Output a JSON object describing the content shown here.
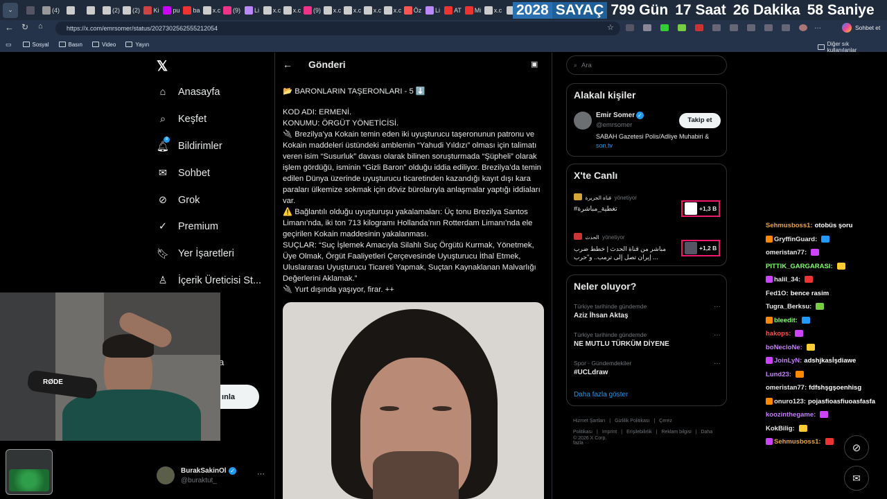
{
  "tabs": [
    "",
    "(4)",
    "",
    "",
    "(2)",
    "(2)",
    "Ki",
    "pu",
    "ba",
    "x.c",
    "(9)",
    "Li",
    "x.c",
    "x.c",
    "(9)",
    "x.c",
    "x.c",
    "x.c",
    "x.c",
    "Öz",
    "Li",
    "AT",
    "Mi",
    "x.c",
    "x"
  ],
  "countdown": {
    "year": "2028",
    "label": "SAYAÇ",
    "days": "799 Gün",
    "hours": "17 Saat",
    "minutes": "26 Dakika",
    "seconds": "58 Saniye"
  },
  "browser": {
    "url": "https://x.com/emrsomer/status/2027302562555212054",
    "chat_label": "Sohbet et"
  },
  "bookmarks": [
    "Sosyal",
    "Basın",
    "Video",
    "Yayın"
  ],
  "bookmarks_other": "Diğer sık kullanılanlar",
  "nav": {
    "home": "Anasayfa",
    "explore": "Keşfet",
    "notifications": "Bildirimler",
    "notif_count": "8",
    "chat": "Sohbet",
    "grok": "Grok",
    "premium": "Premium",
    "bookmarks": "Yer İşaretleri",
    "creator": "İçerik Üreticisi St...",
    "post_frag": "ınla",
    "more_frag": "a"
  },
  "account": {
    "name": "BurakSakinOl",
    "handle": "@buraktut_"
  },
  "post": {
    "header": "Gönderi",
    "lines": [
      "📂 BARONLARIN TAŞERONLARI - 5 ⬇️",
      "",
      "KOD ADI: ERMENİ.",
      "KONUMU: ÖRGÜT YÖNETİCİSİ.",
      "🔌 Brezilya’ya Kokain temin eden iki uyuşturucu taşeronunun patronu ve Kokain maddeleri üstündeki amblemin “Yahudi Yıldızı” olması için talimatı veren isim “Susurluk” davası olarak bilinen soruşturmada “Şüpheli” olarak işlem gördüğü, isminin “Gizli Baron” olduğu iddia ediliyor. Brezilya’da temin edilen Dünya üzerinde uyuşturucu ticaretinden kazandığı kayıt dışı kara paraları ülkemize sokmak için döviz bürolarıyla anlaşmalar yaptığı iddiaları var.",
      "⚠️ Bağlantılı olduğu uyuşturuşu yakalamaları: Üç tonu Brezilya Santos Limanı’nda, iki ton 713 kilogramı Hollanda’nın Rotterdam Limanı’nda ele geçirilen Kokain maddesinin yakalanması.",
      "SUÇLAR: “Suç İşlemek Amacıyla Silahlı Suç Örgütü Kurmak, Yönetmek, Üye Olmak, Örgüt Faaliyetleri Çerçevesinde Uyuşturucu İthal Etmek, Uluslararası Uyuşturucu Ticareti Yapmak, Suçtan Kaynaklanan Malvarlığı Değerlerini Aklamak.”",
      "🔌 Yurt dışında yaşıyor, firar. ++"
    ]
  },
  "search": {
    "placeholder": "Ara"
  },
  "related": {
    "title": "Alakalı kişiler",
    "name": "Emir Somer",
    "handle": "@emrsomer",
    "follow": "Takip et",
    "bio": "SABAH Gazetesi Polis/Adliye Muhabiri & ",
    "bio_link": "son.tv"
  },
  "live": {
    "title": "X'te Canlı",
    "items": [
      {
        "channel": "قناة الجزيرة",
        "role": "yönetiyor",
        "text": "#تغطية_مباشرة",
        "count": "+1,3 B"
      },
      {
        "channel": "الحدث",
        "role": "yönetiyor",
        "text": "مباشر من قناة الحدث | خطط ضرب إيران تصل إلى ترمب.. و\"حرب ...",
        "count": "+1,2 B"
      }
    ]
  },
  "trends": {
    "title": "Neler oluyor?",
    "items": [
      {
        "context": "Türkiye tarihinde gündemde",
        "name": "Aziz İhsan Aktaş"
      },
      {
        "context": "Türkiye tarihinde gündemde",
        "name": "NE MUTLU TÜRKÜM DİYENE"
      },
      {
        "context": "Spor · Gündemdekiler",
        "name": "#UCLdraw"
      }
    ],
    "more": "Daha fazla göster"
  },
  "footer": {
    "links": [
      "Hizmet Şartları",
      "|",
      "Gizlilik Politikası",
      "|",
      "Çerez Politikası",
      "|",
      "Imprint",
      "|",
      "Erişilebilirlik",
      "|",
      "Reklam bilgisi",
      "|",
      "Daha fazla ···"
    ],
    "copy": "© 2026 X Corp."
  },
  "overlay": {
    "mic_brand": "RØDE"
  },
  "chat": [
    {
      "user": "Sehmusboss1:",
      "msg": "otobüs şoru",
      "color": "#e8a44c"
    },
    {
      "user": "GryffinGuard:",
      "msg": "",
      "color": "#e8e8e8"
    },
    {
      "user": "omeristan77:",
      "msg": "",
      "color": "#e8e8e8"
    },
    {
      "user": "PITTIK_GARGARASI:",
      "msg": "",
      "color": "#7dff6a"
    },
    {
      "user": "halil_34:",
      "msg": "",
      "color": "#e8e8e8"
    },
    {
      "user": "Fed1O:",
      "msg": "bence rasim",
      "color": "#e8e8e8"
    },
    {
      "user": "Tugra_Berksu:",
      "msg": "",
      "color": "#e8e8e8"
    },
    {
      "user": "bleedit:",
      "msg": "",
      "color": "#7dff6a"
    },
    {
      "user": "hakops:",
      "msg": "",
      "color": "#ff4d4d"
    },
    {
      "user": "boNecloNe:",
      "msg": "",
      "color": "#c77dff"
    },
    {
      "user": "JoinLyN:",
      "msg": "adshjkasİşdiawe",
      "color": "#c77dff"
    },
    {
      "user": "Lund23:",
      "msg": "",
      "color": "#c77dff"
    },
    {
      "user": "omeristan77:",
      "msg": "fdfshşgşoenhisg",
      "color": "#e8e8e8"
    },
    {
      "user": "onuro123:",
      "msg": "pojasfioasfiuoasfasfa",
      "color": "#e8e8e8"
    },
    {
      "user": "koozinthegame:",
      "msg": "",
      "color": "#c77dff"
    },
    {
      "user": "KokBilig:",
      "msg": "",
      "color": "#e8e8e8"
    },
    {
      "user": "Sehmusboss1:",
      "msg": "",
      "color": "#e8a44c"
    }
  ]
}
